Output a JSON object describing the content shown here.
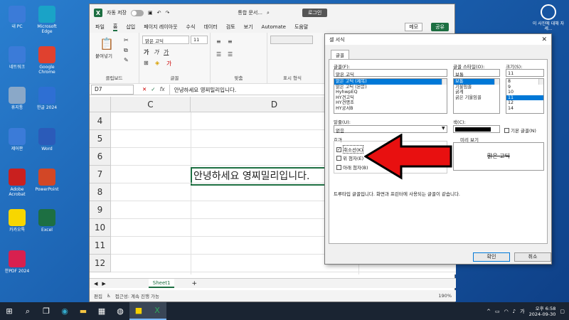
{
  "desktop": {
    "icons_left": [
      {
        "label": "내 PC",
        "icon": "pc-icon",
        "color": "#3b7bd8"
      },
      {
        "label": "Microsoft Edge",
        "icon": "edge-icon",
        "color": "#1aa3c7"
      },
      {
        "label": "네트워크",
        "icon": "network-icon",
        "color": "#3b7bd8"
      },
      {
        "label": "Google Chrome",
        "icon": "chrome-icon",
        "color": "#e0412f"
      },
      {
        "label": "휴지통",
        "icon": "recycle-bin-icon",
        "color": "#8aa8c8"
      },
      {
        "label": "한글 2024",
        "icon": "hangul-icon",
        "color": "#2e6fd3"
      },
      {
        "label": "제어판",
        "icon": "control-panel-icon",
        "color": "#3b7bd8"
      },
      {
        "label": "Word",
        "icon": "word-icon",
        "color": "#2b5bb9"
      },
      {
        "label": "Adobe Acrobat",
        "icon": "acrobat-icon",
        "color": "#c9201f"
      },
      {
        "label": "PowerPoint",
        "icon": "powerpoint-icon",
        "color": "#d24726"
      },
      {
        "label": "카카오톡",
        "icon": "kakaotalk-icon",
        "color": "#f7d600"
      },
      {
        "label": "Excel",
        "icon": "excel-icon",
        "color": "#1d6f42"
      },
      {
        "label": "한PDF 2024",
        "icon": "hanpdf-icon",
        "color": "#d8204f"
      }
    ],
    "icon_right": {
      "label": "이 사진에 대해 자세...",
      "icon": "camera-info-icon"
    }
  },
  "excel": {
    "autosave_label": "자동 저장",
    "title": "통합 문서...",
    "login_label": "로그인",
    "menu": [
      "파일",
      "홈",
      "삽입",
      "페이지 레이아웃",
      "수식",
      "데이터",
      "검토",
      "보기",
      "Automate",
      "도움말"
    ],
    "memo_label": "메모",
    "share_label": "공유",
    "ribbon": {
      "paste_label": "붙여넣기",
      "clipboard_label": "클립보드",
      "font_name": "맑은 고딕",
      "font_size": "11",
      "font_label": "글꼴",
      "align_label": "맞춤",
      "number_label": "표시 형식"
    },
    "name_box": "D7",
    "fx_label": "fx",
    "formula_content": "안녕하세요 영찌밀리입니다.",
    "columns": [
      "C",
      "D"
    ],
    "rows": [
      "4",
      "5",
      "6",
      "7",
      "8",
      "9",
      "10",
      "11",
      "12"
    ],
    "cell_d7": "안녕하세요 영찌밀리입니다.",
    "sheet_tab": "Sheet1",
    "add_sheet": "+",
    "status_edit": "편집",
    "status_accessibility": "접근성: 계속 진행 가능",
    "zoom": "190%"
  },
  "dialog": {
    "title": "셀 서식",
    "close": "✕",
    "tab": "글꼴",
    "font_label": "글꼴(F):",
    "font_value": "맑은 고딕",
    "font_list": [
      "맑은 고딕 (제목)",
      "맑은 고딕 (본문)",
      "HyhwpEQ",
      "HY견고딕",
      "HY견명조",
      "HY궁서B"
    ],
    "style_label": "글꼴 스타일(O):",
    "style_value": "보통",
    "style_list": [
      "보통",
      "기울임꼴",
      "굵게",
      "굵은 기울임꼴"
    ],
    "size_label": "크기(S):",
    "size_value": "11",
    "size_list": [
      "8",
      "9",
      "10",
      "11",
      "12",
      "14"
    ],
    "underline_label": "밑줄(U):",
    "underline_value": "없음",
    "color_label": "색(C):",
    "normal_font_label": "기본 글꼴(N)",
    "effects_label": "효과",
    "strike_label": "취소선(K)",
    "superscript_label": "위 첨자(E)",
    "subscript_label": "아래 첨자(B)",
    "preview_label": "미리 보기",
    "preview_text": "맑은 고딕",
    "info_text": "트루타입 글꼴입니다. 화면과 프린터에 사용되는 글꼴이 같습니다.",
    "ok_label": "확인",
    "cancel_label": "취소"
  },
  "annotation": {
    "arrow_color": "#e81010"
  },
  "taskbar": {
    "time": "오후 6:58",
    "date": "2024-09-30",
    "lang": "가"
  }
}
